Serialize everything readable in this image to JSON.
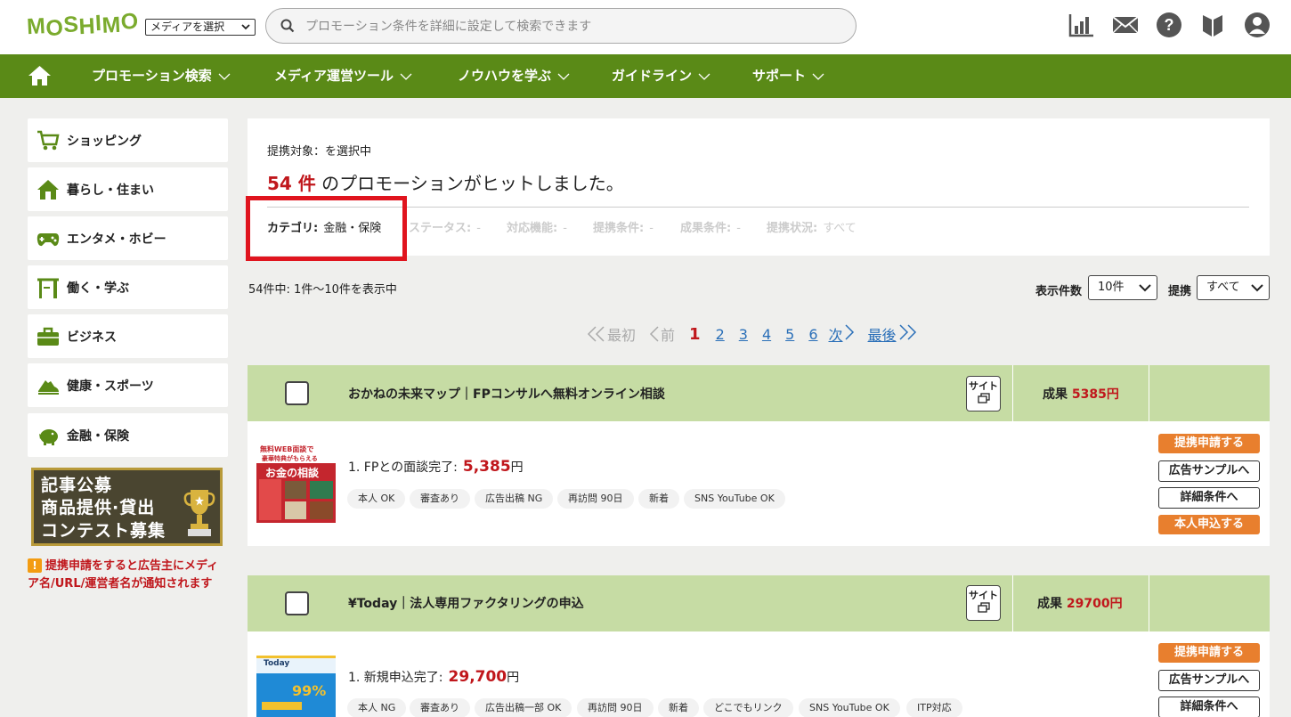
{
  "header": {
    "logo_letters": [
      "M",
      "O",
      "S",
      "H",
      "I",
      "M",
      "O"
    ],
    "media_select": "メディアを選択",
    "search_placeholder": "プロモーション条件を詳細に設定して検索できます"
  },
  "nav": {
    "items": [
      "プロモーション検索",
      "メディア運営ツール",
      "ノウハウを学ぶ",
      "ガイドライン",
      "サポート"
    ]
  },
  "sidebar": {
    "items": [
      "ショッピング",
      "暮らし・住まい",
      "エンタメ・ホビー",
      "働く・学ぶ",
      "ビジネス",
      "健康・スポーツ",
      "金融・保険"
    ],
    "banner_lines": [
      "記事公募",
      "商品提供·貸出",
      "コンテスト募集"
    ],
    "notice": "提携申請をすると広告主にメディア名/URL/運営者名が通知されます"
  },
  "summary": {
    "target": "提携対象：を選択中",
    "count": "54 件",
    "hit_text": " のプロモーションがヒットしました。",
    "filters": [
      {
        "label": "カテゴリ:",
        "value": "金融・保険"
      },
      {
        "label": "ステータス:",
        "value": "-"
      },
      {
        "label": "対応機能:",
        "value": "-"
      },
      {
        "label": "提携条件:",
        "value": "-"
      },
      {
        "label": "成果条件:",
        "value": "-"
      },
      {
        "label": "提携状況:",
        "value": "すべて"
      }
    ]
  },
  "list_controls": {
    "range": "54件中: 1件～10件を表示中",
    "per_page_label": "表示件数",
    "per_page_value": "10件",
    "partner_label": "提携",
    "partner_value": "すべて"
  },
  "pager": {
    "first": "最初",
    "prev": "前",
    "current": "1",
    "pages": [
      "2",
      "3",
      "4",
      "5",
      "6"
    ],
    "next": "次",
    "last": "最後"
  },
  "cards": [
    {
      "title": "おかねの未来マップ｜FPコンサルへ無料オンライン相談",
      "site_label": "サイト",
      "reward_label": "成果",
      "reward_amount": "5385円",
      "condition": "1. FPとの面談完了:",
      "condition_amount": "5,385",
      "condition_unit": "円",
      "tags": [
        "本人 OK",
        "審査あり",
        "広告出稿 NG",
        "再訪問 90日",
        "新着",
        "SNS YouTube OK"
      ],
      "buttons": [
        "提携申請する",
        "広告サンプルへ",
        "詳細条件へ",
        "本人申込する"
      ],
      "thumb_text": [
        "無料WEB面談で",
        "豪華特典がもらえる",
        "お金の相談"
      ]
    },
    {
      "title": "¥Today｜法人専用ファクタリングの申込",
      "site_label": "サイト",
      "reward_label": "成果",
      "reward_amount": "29700円",
      "condition": "1. 新規申込完了:",
      "condition_amount": "29,700",
      "condition_unit": "円",
      "tags": [
        "本人 NG",
        "審査あり",
        "広告出稿一部 OK",
        "再訪問 90日",
        "新着",
        "どこでもリンク",
        "SNS YouTube OK",
        "ITP対応"
      ],
      "buttons": [
        "提携申請する",
        "広告サンプルへ",
        "詳細条件へ"
      ],
      "thumb_text": [
        "Today",
        "99%"
      ]
    }
  ],
  "colors": {
    "brand_green": "#5a8a17",
    "card_header": "#c6dca4",
    "accent_red": "#c0171c",
    "action_orange": "#e87f2e",
    "highlight_box": "#e0141e"
  }
}
